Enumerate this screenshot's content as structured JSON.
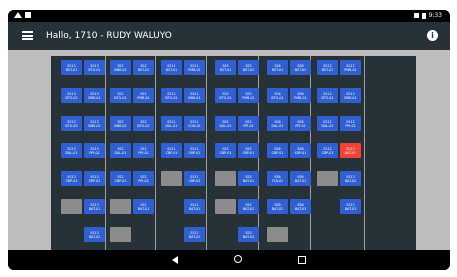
{
  "status": {
    "time": "9:33"
  },
  "header": {
    "title": "Hallo, 1710 - RUDY WALUYO"
  },
  "tiles": [
    {
      "l1": "SS13",
      "l2": "BST-01",
      "red": false
    },
    {
      "l1": "SS13",
      "l2": "BTG-01",
      "red": false
    },
    {
      "l1": "SS2",
      "l2": "BNR-01",
      "red": false
    },
    {
      "l1": "SS2",
      "l2": "BST-02",
      "red": false
    },
    {
      "l1": "SS11",
      "l2": "BST-01",
      "red": false
    },
    {
      "l1": "SS11",
      "l2": "PMB-01",
      "red": false
    },
    {
      "l1": "SS5",
      "l2": "BST-01",
      "red": false
    },
    {
      "l1": "SS5",
      "l2": "BST-02",
      "red": false
    },
    {
      "l1": "SS6",
      "l2": "BST-01",
      "red": false
    },
    {
      "l1": "SS6",
      "l2": "BST-02",
      "red": false
    },
    {
      "l1": "SS12",
      "l2": "BST-01",
      "red": false
    },
    {
      "l1": "SS12",
      "l2": "PMB-01",
      "red": false
    },
    {
      "l1": "SS13",
      "l2": "BTG-02",
      "red": false
    },
    {
      "l1": "SS13",
      "l2": "BNR-01",
      "red": false
    },
    {
      "l1": "SS2",
      "l2": "BTG-01",
      "red": false
    },
    {
      "l1": "SS2",
      "l2": "PMB-01",
      "red": false
    },
    {
      "l1": "SS11",
      "l2": "BTG-01",
      "red": false
    },
    {
      "l1": "SS11",
      "l2": "BNR-01",
      "red": false
    },
    {
      "l1": "SS5",
      "l2": "BTG-01",
      "red": false
    },
    {
      "l1": "SS5",
      "l2": "PMB-01",
      "red": false
    },
    {
      "l1": "SS6",
      "l2": "BTG-01",
      "red": false
    },
    {
      "l1": "SS6",
      "l2": "PMB-01",
      "red": false
    },
    {
      "l1": "SS12",
      "l2": "BTG-01",
      "red": false
    },
    {
      "l1": "SS12",
      "l2": "BNR-01",
      "red": false
    },
    {
      "l1": "SS13",
      "l2": "BTG-03",
      "red": false
    },
    {
      "l1": "SS13",
      "l2": "BNR-02",
      "red": false
    },
    {
      "l1": "SS2",
      "l2": "BNR-02",
      "red": false
    },
    {
      "l1": "SS2",
      "l2": "BTG-02",
      "red": false
    },
    {
      "l1": "SS11",
      "l2": "DAL-01",
      "red": false
    },
    {
      "l1": "SS11",
      "l2": "CON-01",
      "red": false
    },
    {
      "l1": "SS5",
      "l2": "DAL-01",
      "red": false
    },
    {
      "l1": "SS5",
      "l2": "PPI-01",
      "red": false
    },
    {
      "l1": "SS6",
      "l2": "DAL-01",
      "red": false
    },
    {
      "l1": "SS6",
      "l2": "PPI-01",
      "red": false
    },
    {
      "l1": "SS12",
      "l2": "DAL-01",
      "red": false
    },
    {
      "l1": "SS12",
      "l2": "PPI-01",
      "red": false
    },
    {
      "l1": "SS13",
      "l2": "DAL-01",
      "red": false
    },
    {
      "l1": "SS13",
      "l2": "PPI-01",
      "red": false
    },
    {
      "l1": "SS2",
      "l2": "DAL-01",
      "red": false
    },
    {
      "l1": "SS2",
      "l2": "PPI-01",
      "red": false
    },
    {
      "l1": "SS11",
      "l2": "CBP-01",
      "red": false
    },
    {
      "l1": "SS11",
      "l2": "SRP-01",
      "red": false
    },
    {
      "l1": "SS5",
      "l2": "CBP-01",
      "red": false
    },
    {
      "l1": "SS5",
      "l2": "SRP-01",
      "red": false
    },
    {
      "l1": "SS6",
      "l2": "CBP-01",
      "red": false
    },
    {
      "l1": "SS6",
      "l2": "SRP-01",
      "red": false
    },
    {
      "l1": "SS12",
      "l2": "CBP-01",
      "red": false
    },
    {
      "l1": "SS12",
      "l2": "BAT-01",
      "red": true
    },
    {
      "l1": "SS13",
      "l2": "CBP-01",
      "red": false
    },
    {
      "l1": "SS13",
      "l2": "SRP-01",
      "red": false
    },
    {
      "l1": "SS2",
      "l2": "CBP-01",
      "red": false
    },
    {
      "l1": "SS2",
      "l2": "PPI-02",
      "red": false
    },
    {
      "l1": "SS11",
      "l2": "CBP-02",
      "red": false
    },
    {
      "l1": "SS5",
      "l2": "BAT-01",
      "red": false
    },
    {
      "l1": "SS6",
      "l2": "FLR-01",
      "red": false
    },
    {
      "l1": "SS6",
      "l2": "BAT-01",
      "red": false
    },
    {
      "l1": "SS6",
      "l2": "PPI-02",
      "red": false
    },
    {
      "l1": "SS12",
      "l2": "BAT-02",
      "red": false
    },
    {
      "l1": "SS13",
      "l2": "BAT-01",
      "red": false
    },
    {
      "l1": "SS2",
      "l2": "BAT-01",
      "red": false
    },
    {
      "l1": "SS11",
      "l2": "BAT-01",
      "red": false
    },
    {
      "l1": "SS5",
      "l2": "BAT-02",
      "red": false
    },
    {
      "l1": "SS6",
      "l2": "BAT-02",
      "red": false
    },
    {
      "l1": "SS6",
      "l2": "BAT-03",
      "red": false
    },
    {
      "l1": "SS12",
      "l2": "BAT-03",
      "red": false
    },
    {
      "l1": "SS13",
      "l2": "BAT-02",
      "red": false
    },
    {
      "l1": "SS11",
      "l2": "BAT-02",
      "red": false
    },
    {
      "l1": "SS5",
      "l2": "BAT-03",
      "red": false
    },
    {
      "l1": "SS13",
      "l2": "BAT-03",
      "red": false
    }
  ],
  "colors": {
    "accent": "#2f5fd0",
    "alert": "#f44336",
    "appbar": "#263238",
    "board": "#263238"
  },
  "icons": {
    "menu": "hamburger-menu-icon",
    "info": "info-icon",
    "back": "back-icon",
    "home": "home-icon",
    "recents": "recents-icon"
  },
  "info_glyph": "i"
}
